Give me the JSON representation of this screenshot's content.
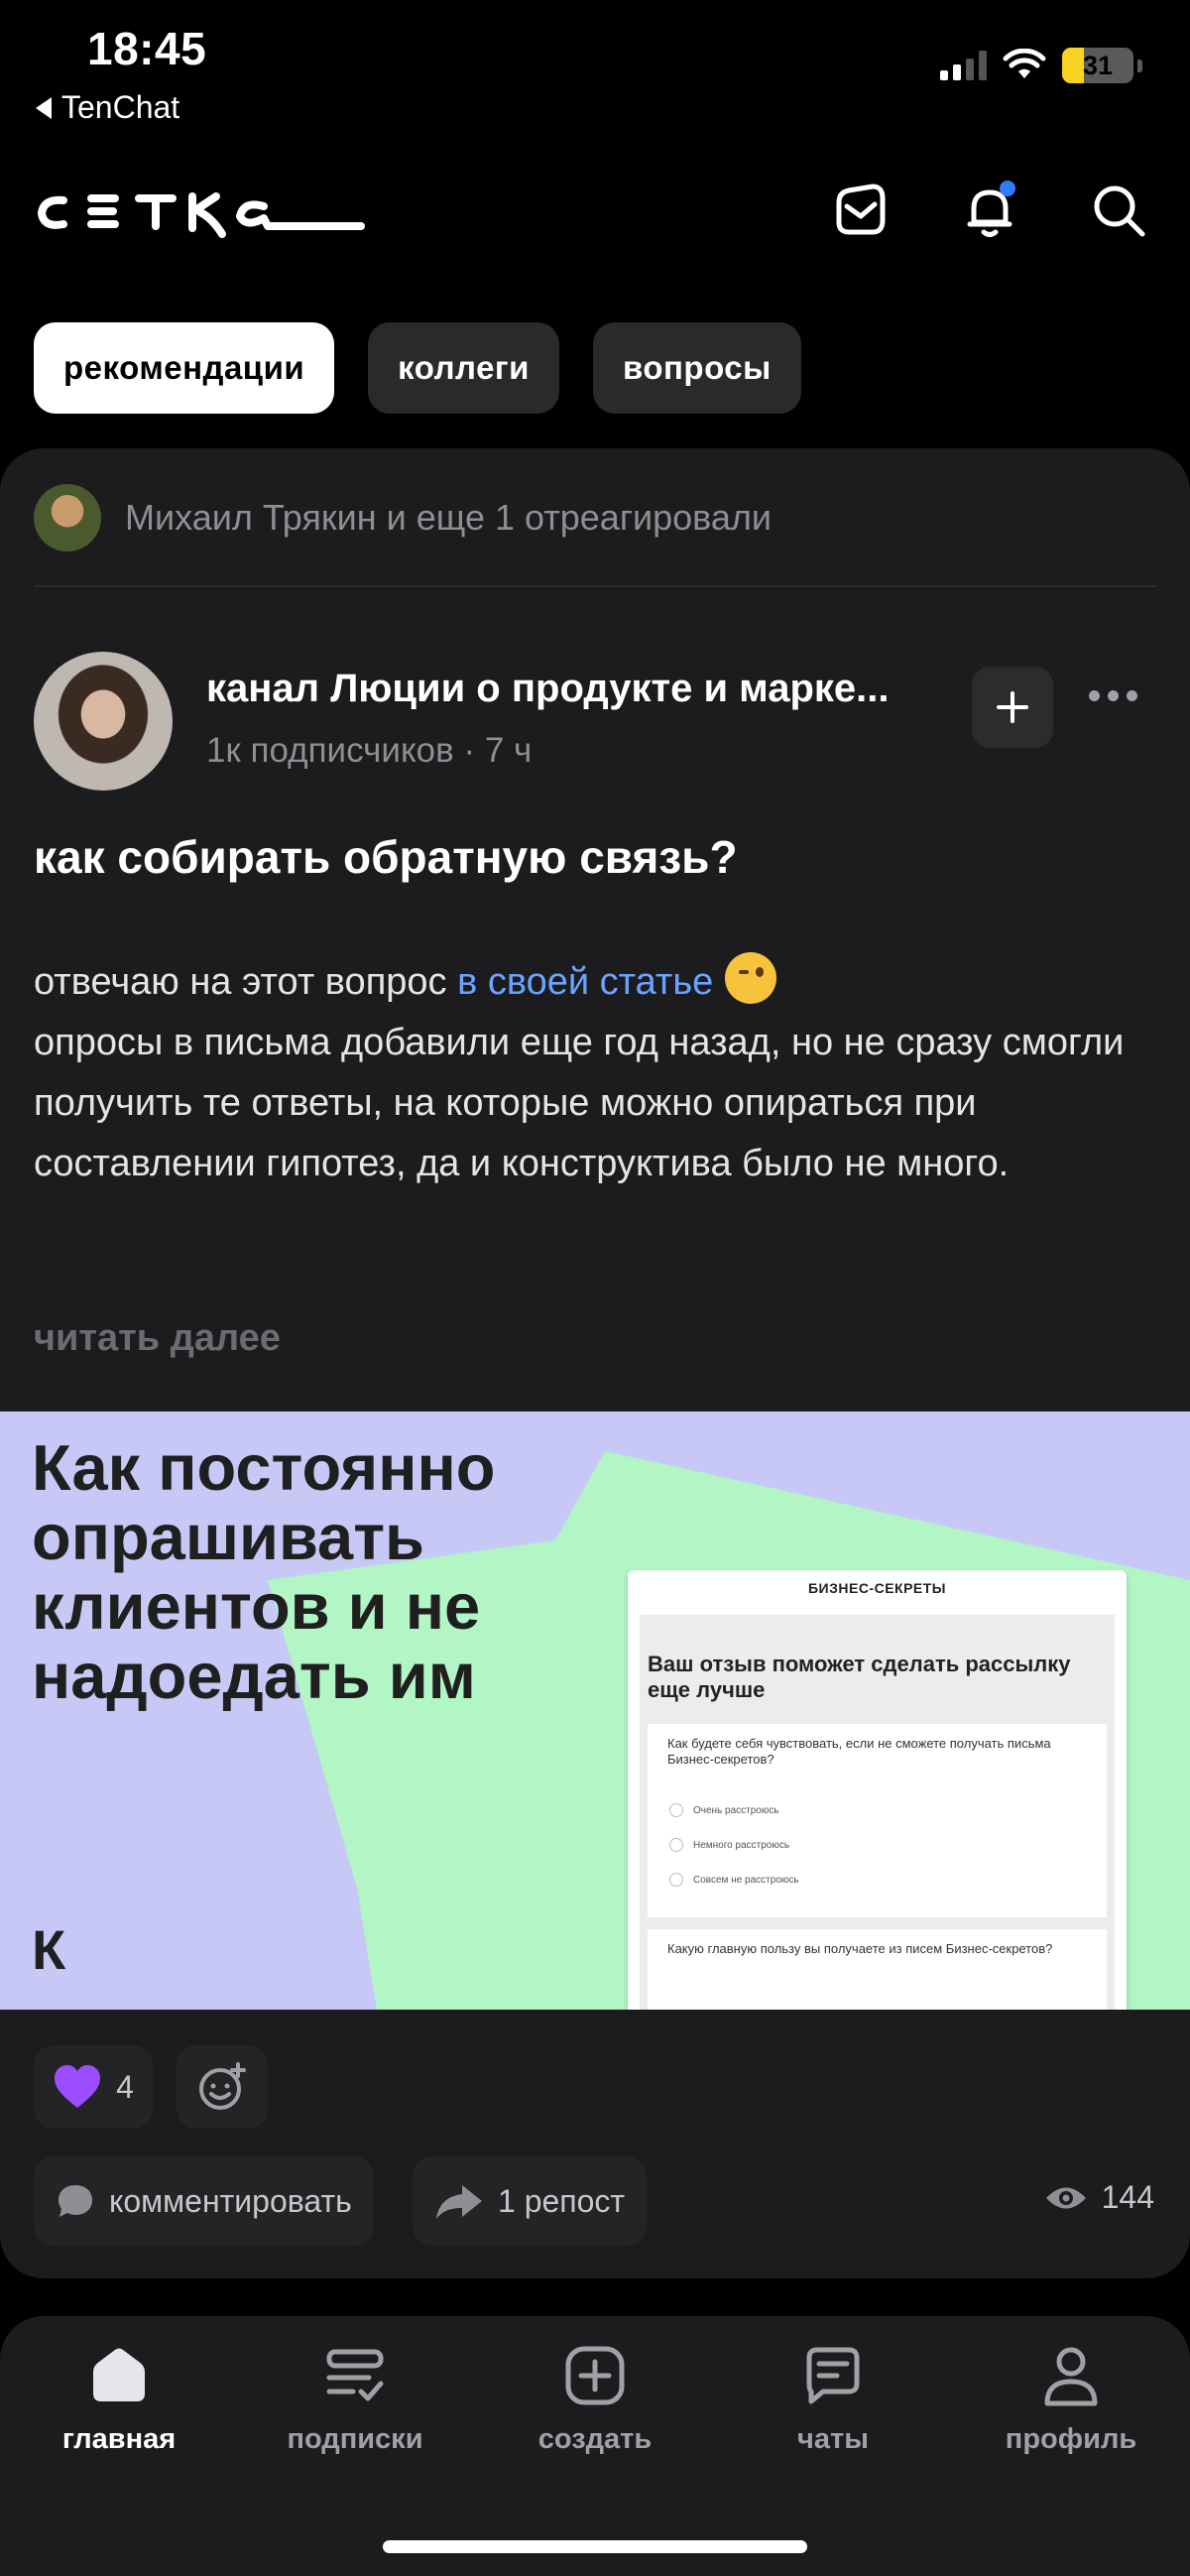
{
  "status_bar": {
    "time": "18:45",
    "back_app": "TenChat",
    "battery": "31",
    "battery_level": 0.31
  },
  "header": {
    "logo_text": "СЕТКА",
    "icons": [
      "mail-icon",
      "bell-icon",
      "search-icon"
    ]
  },
  "tabs": [
    {
      "label": "рекомендации",
      "active": true
    },
    {
      "label": "коллеги",
      "active": false
    },
    {
      "label": "вопросы",
      "active": false
    }
  ],
  "post": {
    "reacted_text": "Михаил Трякин и еще 1 отреагировали",
    "author_name": "канал Люции о продукте и марке...",
    "author_meta": "1к подписчиков · 7 ч",
    "title": "как собирать обратную связь?",
    "body_intro": "отвечаю на этот вопрос ",
    "body_link": "в своей статье",
    "body_rest": "опросы в письма добавили еще год назад, но не сразу смогли получить те ответы, на которые можно опираться при составлении гипотез, да и конструктива было не много.",
    "read_more": "читать далее",
    "image": {
      "headline": "Как постоянно опрашивать клиентов и не надоедать им",
      "logo": "К",
      "form_brand": "БИЗНЕС-СЕКРЕТЫ",
      "form_title": "Ваш отзыв поможет сделать рассылку еще лучше",
      "question1": "Как будете себя чувствовать, если не сможете получать письма Бизнес-секретов?",
      "options": [
        "Очень расстроюсь",
        "Немного расстроюсь",
        "Совсем не расстроюсь"
      ],
      "question2": "Какую главную пользу вы получаете из писем Бизнес-секретов?"
    },
    "reaction_count": "4",
    "comment_label": "комментировать",
    "repost_label": "1 репост",
    "views": "144"
  },
  "bottom_nav": [
    {
      "label": "главная",
      "icon": "home-icon",
      "active": true
    },
    {
      "label": "подписки",
      "icon": "subscriptions-icon",
      "active": false
    },
    {
      "label": "создать",
      "icon": "create-icon",
      "active": false
    },
    {
      "label": "чаты",
      "icon": "chat-icon",
      "active": false
    },
    {
      "label": "профиль",
      "icon": "profile-icon",
      "active": false
    }
  ],
  "colors": {
    "background": "#000000",
    "card": "#1c1c1e",
    "link": "#6aa3ff",
    "battery": "#f7d31f",
    "article_bg": "#c7c8f6",
    "article_accent": "#b1f6c4"
  }
}
